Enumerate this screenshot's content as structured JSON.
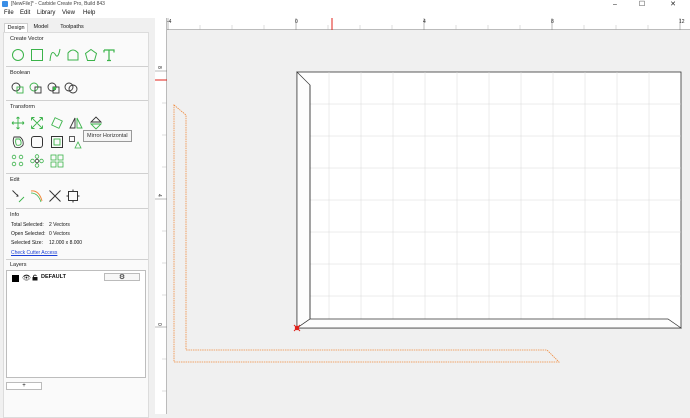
{
  "titlebar": {
    "title": "[NewFile]* - Carbide Create Pro, Build 843",
    "minimize": "–",
    "maximize": "☐",
    "close": "✕"
  },
  "menu": [
    "File",
    "Edit",
    "Library",
    "View",
    "Help"
  ],
  "tabs": [
    "Design",
    "Model",
    "Toolpaths"
  ],
  "sections": {
    "create_vector": "Create Vector",
    "boolean": "Boolean",
    "transform": "Transform",
    "edit": "Edit",
    "info": "Info",
    "layers": "Layers"
  },
  "tooltip": "Mirror Horizontal",
  "info": {
    "total_selected_label": "Total Selected:",
    "total_selected_value": "2 Vectors",
    "open_selected_label": "Open Selected:",
    "open_selected_value": "0 Vectors",
    "selected_size_label": "Selected Size:",
    "selected_size_value": "12.000 x 8.000",
    "link": "Check Cutter Access"
  },
  "layers": {
    "items": [
      {
        "name": "DEFAULT",
        "color": "#000000"
      }
    ],
    "settings_icon": "gear-icon",
    "add_label": "+"
  },
  "rulers": {
    "horizontal": [
      "-4",
      "0",
      "4",
      "8",
      "12"
    ],
    "vertical": [
      "8",
      "4",
      "0"
    ]
  },
  "colors": {
    "tool_green": "#3bb34a",
    "toolpath_orange": "#f08a3c",
    "marker_red": "#e0201a",
    "link_blue": "#1a3fd6"
  }
}
